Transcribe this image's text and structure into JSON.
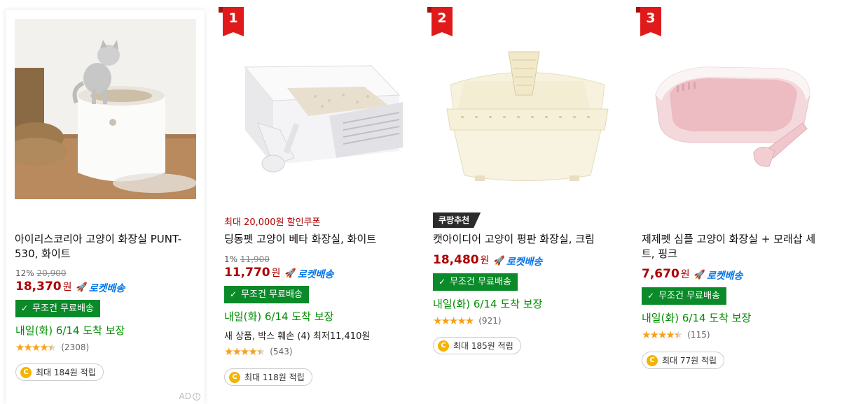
{
  "products": [
    {
      "title": "아이리스코리아 고양이 화장실 PUNT-530, 화이트",
      "discount": "12%",
      "original_price": "20,900",
      "price": "18,370",
      "won": "원",
      "rocket": "로켓배송",
      "free_shipping": "무조건 무료배송",
      "arrival": "내일(화) 6/14 도착 보장",
      "stars": "★★★★★",
      "rating": 4.5,
      "review_count": "(2308)",
      "cashback": "최대 184원 적립",
      "ad_label": "AD"
    },
    {
      "rank": "1",
      "coupon": "최대 20,000원 할인쿠폰",
      "title": "딩동펫 고양이 베타 화장실, 화이트",
      "discount": "1%",
      "original_price": "11,900",
      "price": "11,770",
      "won": "원",
      "rocket": "로켓배송",
      "free_shipping": "무조건 무료배송",
      "arrival": "내일(화) 6/14 도착 보장",
      "extra": "새 상품, 박스 훼손 (4) 최저11,410원",
      "stars": "★★★★★",
      "rating": 4.5,
      "review_count": "(543)",
      "cashback": "최대 118원 적립"
    },
    {
      "rank": "2",
      "badge": "쿠팡추천",
      "title": "캣아이디어 고양이 평판 화장실, 크림",
      "price": "18,480",
      "won": "원",
      "rocket": "로켓배송",
      "free_shipping": "무조건 무료배송",
      "arrival": "내일(화) 6/14 도착 보장",
      "stars": "★★★★★",
      "rating": 5,
      "review_count": "(921)",
      "cashback": "최대 185원 적립"
    },
    {
      "rank": "3",
      "title": "제제펫 심플 고양이 화장실 + 모래삽 세트, 핑크",
      "price": "7,670",
      "won": "원",
      "rocket": "로켓배송",
      "free_shipping": "무조건 무료배송",
      "arrival": "내일(화) 6/14 도착 보장",
      "stars": "★★★★★",
      "rating": 4.5,
      "review_count": "(115)",
      "cashback": "최대 77원 적립"
    }
  ],
  "icons": {
    "check": "✓",
    "coin": "C",
    "rocket": "🚀",
    "info": "i"
  },
  "colors": {
    "price_red": "#ae0000",
    "rocket_blue": "#0073e9",
    "free_green": "#0a8a28",
    "arrival_green": "#008c00",
    "rank_red": "#e01a1a",
    "star_orange": "#f6a01a"
  }
}
